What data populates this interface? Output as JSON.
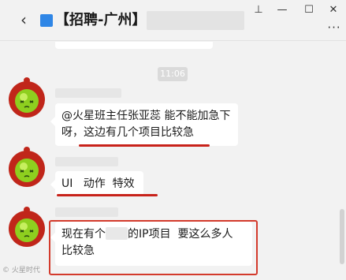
{
  "titlebar": {
    "back_icon": "chevron-left-icon",
    "home_icon": "home-icon",
    "title": "【招聘-广州】",
    "pin_symbol": "⊥",
    "minimize_symbol": "—",
    "maximize_symbol": "☐",
    "close_symbol": "✕",
    "more_symbol": "···"
  },
  "chat": {
    "timestamp": "11:06",
    "messages": [
      {
        "line1": "@火星班主任张亚蕊 能不能加急下",
        "line2": "呀，这边有几个项目比较急"
      },
      {
        "line1": "UI   动作  特效"
      },
      {
        "line1_prefix": "现在有个",
        "line1_suffix": "的IP项目  要这么多人",
        "line2": "比较急"
      }
    ]
  },
  "watermark": "© 火星时代",
  "colors": {
    "accent_red": "#d33a2c",
    "background": "#f2f2f2",
    "bubble": "#ffffff"
  }
}
